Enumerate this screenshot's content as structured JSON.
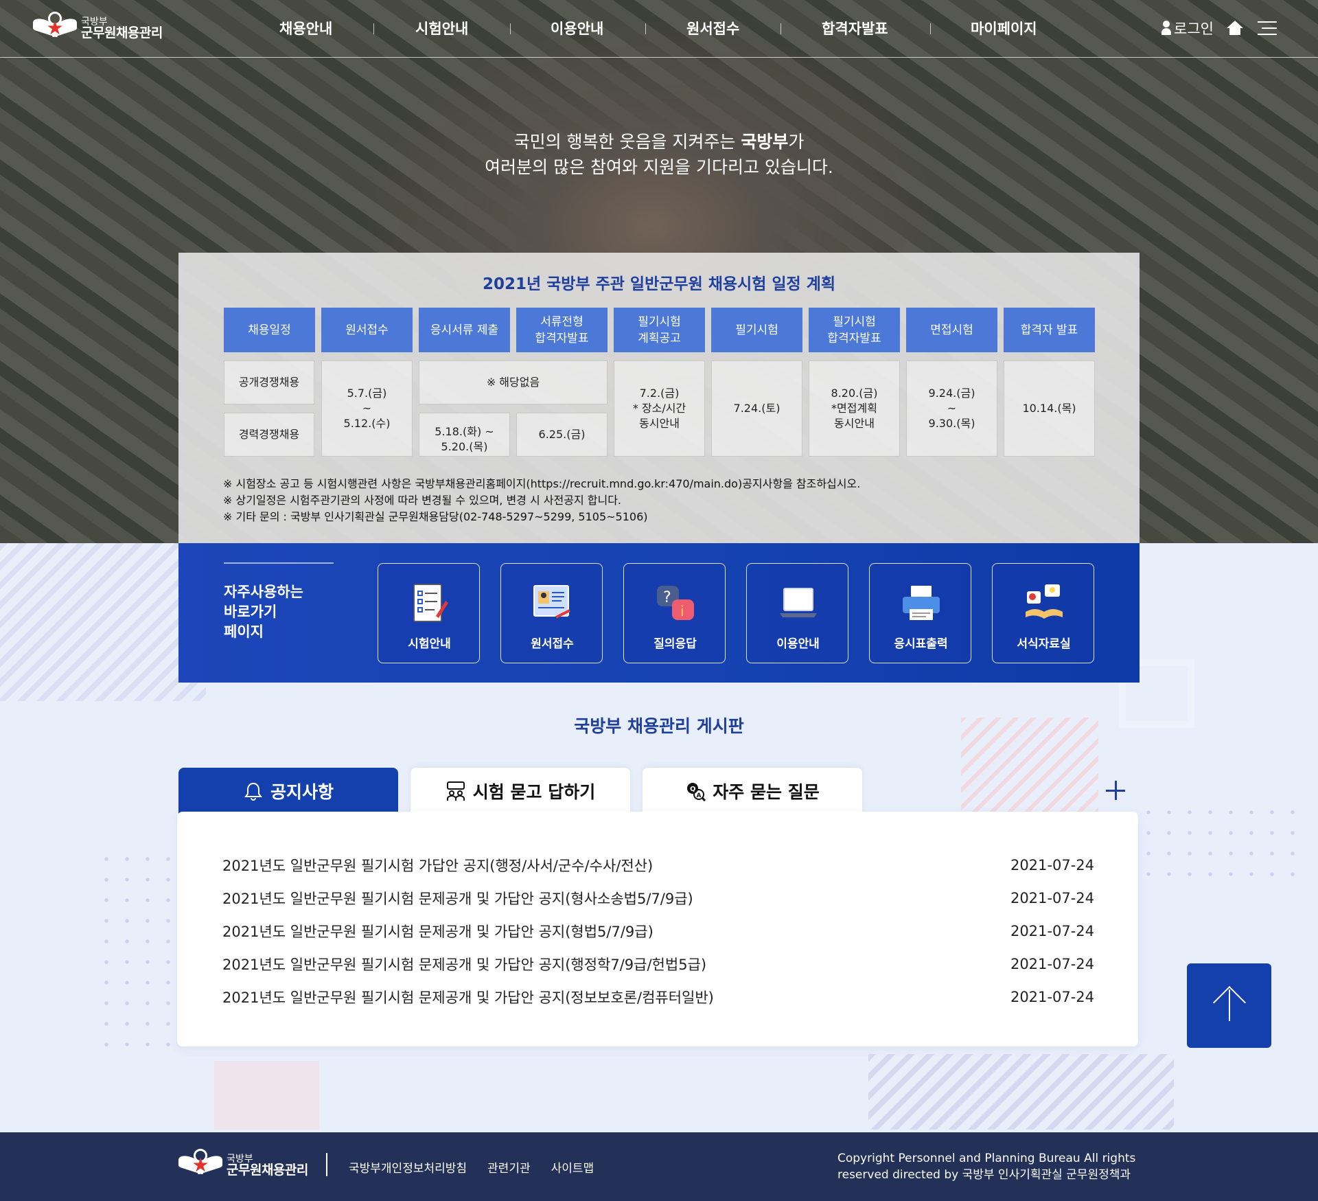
{
  "header": {
    "logo_top": "국방부",
    "logo_bottom": "군무원채용관리",
    "menu": [
      "채용안내",
      "시험안내",
      "이용안내",
      "원서접수",
      "합격자발표",
      "마이페이지"
    ],
    "login": "로그인"
  },
  "hero": {
    "line1_a": "국민의 행복한 웃음을 지켜주는 ",
    "line1_b": "국방부",
    "line1_c": "가",
    "line2": "여러분의 많은 참여와 지원을 기다리고 있습니다."
  },
  "schedule": {
    "title": "2021년 국방부 주관 일반군무원 채용시험 일정 계획",
    "headers": [
      "채용일정",
      "원서접수",
      "응시서류 제출",
      "서류전형\n합격자발표",
      "필기시험\n계획공고",
      "필기시험",
      "필기시험\n합격자발표",
      "면접시험",
      "합격자 발표"
    ],
    "row_public": "공개경쟁채용",
    "row_career": "경력경쟁채용",
    "apply": "5.7.(금)\n~\n5.12.(수)",
    "none": "※ 해당없음",
    "docs_career": "5.18.(화) ~\n5.20.(목)",
    "doc_result_career": "6.25.(금)",
    "written_notice": "7.2.(금)\n* 장소/시간\n동시안내",
    "written": "7.24.(토)",
    "written_result": "8.20.(금)\n*면접계획\n동시안내",
    "interview": "9.24.(금)\n~\n9.30.(목)",
    "final": "10.14.(목)",
    "notes": [
      "※ 시험장소 공고 등 시험시행관련 사항은 국방부채용관리홈페이지(https://recruit.mnd.go.kr:470/main.do)공지사항을 참조하십시오.",
      "※ 상기일정은 시험주관기관의 사정에 따라 변경될 수 있으며, 변경 시 사전공지 합니다.",
      "※ 기타 문의 : 국방부 인사기획관실 군무원채용담당(02-748-5297~5299, 5105~5106)"
    ]
  },
  "quick": {
    "title": "자주사용하는\n바로가기\n페이지",
    "items": [
      {
        "label": "시험안내",
        "icon": "checklist-icon"
      },
      {
        "label": "원서접수",
        "icon": "application-form-icon"
      },
      {
        "label": "질의응답",
        "icon": "question-info-icon"
      },
      {
        "label": "이용안내",
        "icon": "laptop-icon"
      },
      {
        "label": "응시표출력",
        "icon": "printer-icon"
      },
      {
        "label": "서식자료실",
        "icon": "document-book-icon"
      }
    ]
  },
  "board": {
    "title": "국방부 채용관리 게시판",
    "tabs": [
      {
        "label": "공지사항",
        "icon": "bell-icon"
      },
      {
        "label": "시험 묻고 답하기",
        "icon": "chat-users-icon"
      },
      {
        "label": "자주 묻는 질문",
        "icon": "faq-search-icon"
      }
    ],
    "items": [
      {
        "title": "2021년도 일반군무원 필기시험 가답안 공지(행정/사서/군수/수사/전산)",
        "date": "2021-07-24"
      },
      {
        "title": "2021년도 일반군무원 필기시험 문제공개 및 가답안 공지(형사소송법5/7/9급)",
        "date": "2021-07-24"
      },
      {
        "title": "2021년도 일반군무원 필기시험 문제공개 및 가답안 공지(형법5/7/9급)",
        "date": "2021-07-24"
      },
      {
        "title": "2021년도 일반군무원 필기시험 문제공개 및 가답안 공지(행정학7/9급/헌법5급)",
        "date": "2021-07-24"
      },
      {
        "title": "2021년도 일반군무원 필기시험 문제공개 및 가답안 공지(정보보호론/컴퓨터일반)",
        "date": "2021-07-24"
      }
    ]
  },
  "footer": {
    "logo_top": "국방부",
    "logo_bottom": "군무원채용관리",
    "links": [
      "국방부개인정보처리방침",
      "관련기관",
      "사이트맵"
    ],
    "copy_1": "Copyright Personnel and Planning Bureau All rights",
    "copy_2": "reserved directed by 국방부 인사기획관실 군무원정책과"
  },
  "colors": {
    "primary": "#1340ad",
    "header_cell": "#4c79d8",
    "title_blue": "#1e3f9e",
    "footer_bg": "#233058"
  }
}
